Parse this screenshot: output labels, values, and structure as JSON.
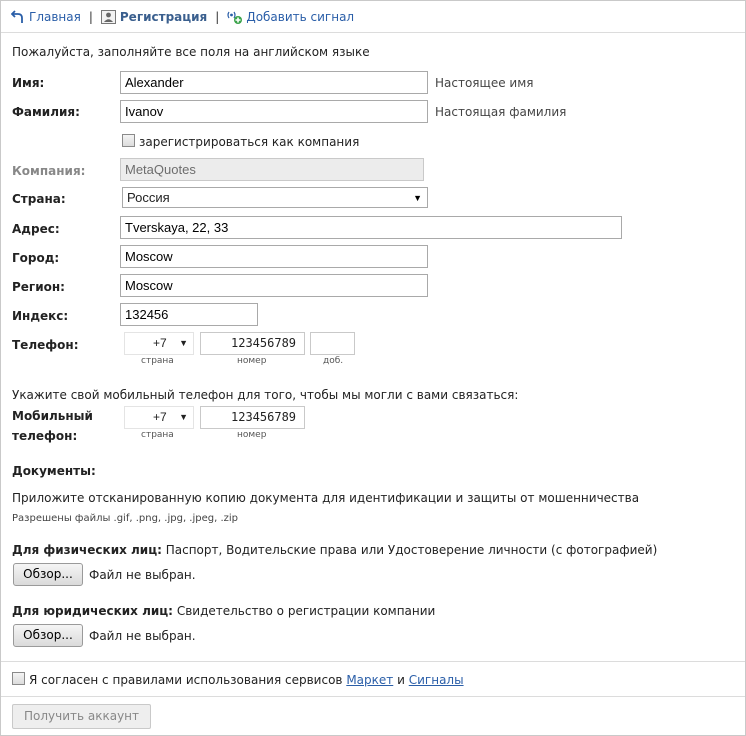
{
  "nav": {
    "home": "Главная",
    "register": "Регистрация",
    "add_signal": "Добавить сигнал",
    "separator": "|"
  },
  "intro": "Пожалуйста, заполняйте все поля на английском языке",
  "fields": {
    "first_name": {
      "label": "Имя:",
      "value": "Alexander",
      "hint": "Настоящее имя"
    },
    "last_name": {
      "label": "Фамилия:",
      "value": "Ivanov",
      "hint": "Настоящая фамилия"
    },
    "company_checkbox": {
      "label": "зарегистрироваться как компания",
      "checked": false
    },
    "company": {
      "label": "Компания:",
      "placeholder": "MetaQuotes"
    },
    "country": {
      "label": "Страна:",
      "value": "Россия"
    },
    "address": {
      "label": "Адрес:",
      "value": "Tverskaya, 22, 33"
    },
    "city": {
      "label": "Город:",
      "value": "Moscow"
    },
    "region": {
      "label": "Регион:",
      "value": "Moscow"
    },
    "postcode": {
      "label": "Индекс:",
      "value": "132456"
    },
    "phone": {
      "label": "Телефон:",
      "code": "+7",
      "number": "123456789",
      "ext": "",
      "code_sub": "страна",
      "number_sub": "номер",
      "ext_sub": "доб."
    }
  },
  "mobile": {
    "intro": "Укажите свой мобильный телефон для того, чтобы мы могли с вами связаться:",
    "label_line1": "Мобильный",
    "label_line2": "телефон:",
    "code": "+7",
    "number": "123456789",
    "code_sub": "страна",
    "number_sub": "номер"
  },
  "documents": {
    "title": "Документы:",
    "desc": "Приложите отсканированную копию документа для идентификации и защиты от мошенничества",
    "allowed": "Разрешены файлы .gif, .png, .jpg, .jpeg, .zip",
    "individual_label": "Для физических лиц:",
    "individual_desc": "Паспорт, Водительские права или Удостоверение личности (с фотографией)",
    "legal_label": "Для юридических лиц:",
    "legal_desc": "Свидетельство о регистрации компании",
    "browse_label": "Обзор...",
    "no_file": "Файл не выбран."
  },
  "agreement": {
    "text": "Я согласен с правилами использования сервисов",
    "link_market": "Маркет",
    "and": "и",
    "link_signals": "Сигналы",
    "checked": false
  },
  "submit_label": "Получить аккаунт",
  "colors": {
    "link": "#2a5ea8",
    "nav_active": "#3a5f8e",
    "border": "#a9a9a9"
  }
}
